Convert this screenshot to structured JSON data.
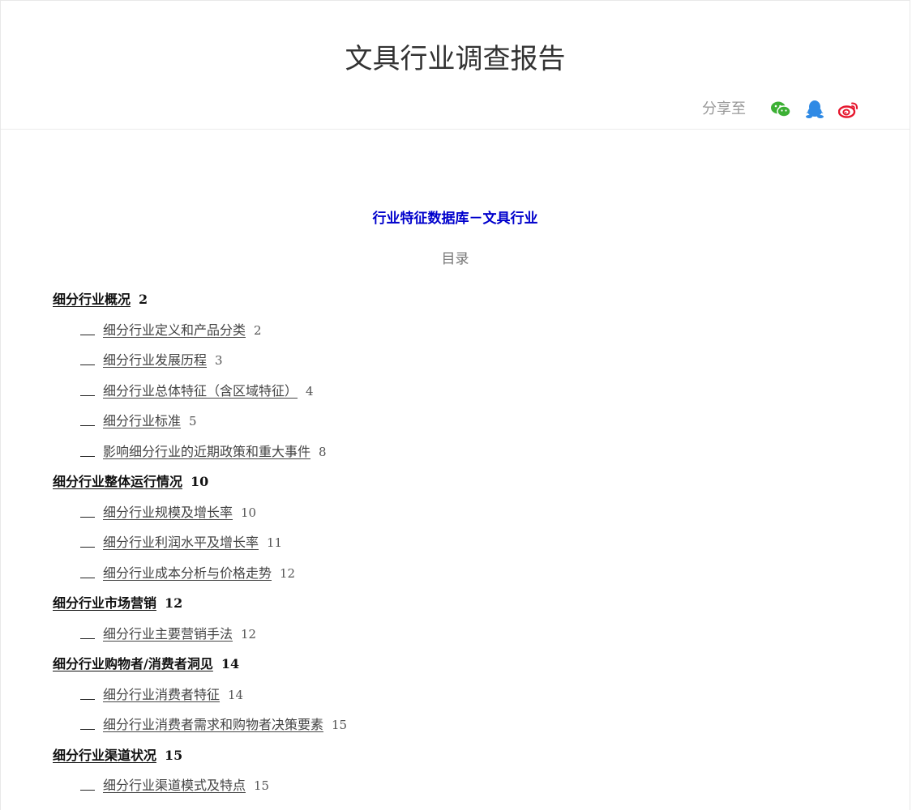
{
  "header": {
    "title": "文具行业调查报告",
    "share_label": "分享至",
    "share_icons": [
      {
        "name": "wechat-icon",
        "color": "#3cb034"
      },
      {
        "name": "qq-icon",
        "color": "#2f8ae5"
      },
      {
        "name": "weibo-icon",
        "color": "#e6162d"
      }
    ]
  },
  "document": {
    "subtitle": "行业特征数据库－文具行业",
    "toc_heading": "目录",
    "toc": [
      {
        "level": 1,
        "text": "细分行业概况",
        "page": "2"
      },
      {
        "level": 2,
        "text": "细分行业定义和产品分类",
        "page": "2"
      },
      {
        "level": 2,
        "text": "细分行业发展历程",
        "page": "3"
      },
      {
        "level": 2,
        "text": "细分行业总体特征（含区域特征）",
        "page": "4"
      },
      {
        "level": 2,
        "text": "细分行业标准",
        "page": "5"
      },
      {
        "level": 2,
        "text": "影响细分行业的近期政策和重大事件",
        "page": "8"
      },
      {
        "level": 1,
        "text": "细分行业整体运行情况",
        "page": "10"
      },
      {
        "level": 2,
        "text": "细分行业规模及增长率",
        "page": "10"
      },
      {
        "level": 2,
        "text": "细分行业利润水平及增长率",
        "page": "11"
      },
      {
        "level": 2,
        "text": "细分行业成本分析与价格走势",
        "page": "12"
      },
      {
        "level": 1,
        "text": "细分行业市场营销",
        "page": "12"
      },
      {
        "level": 2,
        "text": "细分行业主要营销手法",
        "page": "12"
      },
      {
        "level": 1,
        "text": "细分行业购物者/消费者洞见",
        "page": "14"
      },
      {
        "level": 2,
        "text": "细分行业消费者特征",
        "page": "14"
      },
      {
        "level": 2,
        "text": "细分行业消费者需求和购物者决策要素",
        "page": "15"
      },
      {
        "level": 1,
        "text": "细分行业渠道状况",
        "page": "15"
      },
      {
        "level": 2,
        "text": "细分行业渠道模式及特点",
        "page": "15"
      }
    ]
  }
}
